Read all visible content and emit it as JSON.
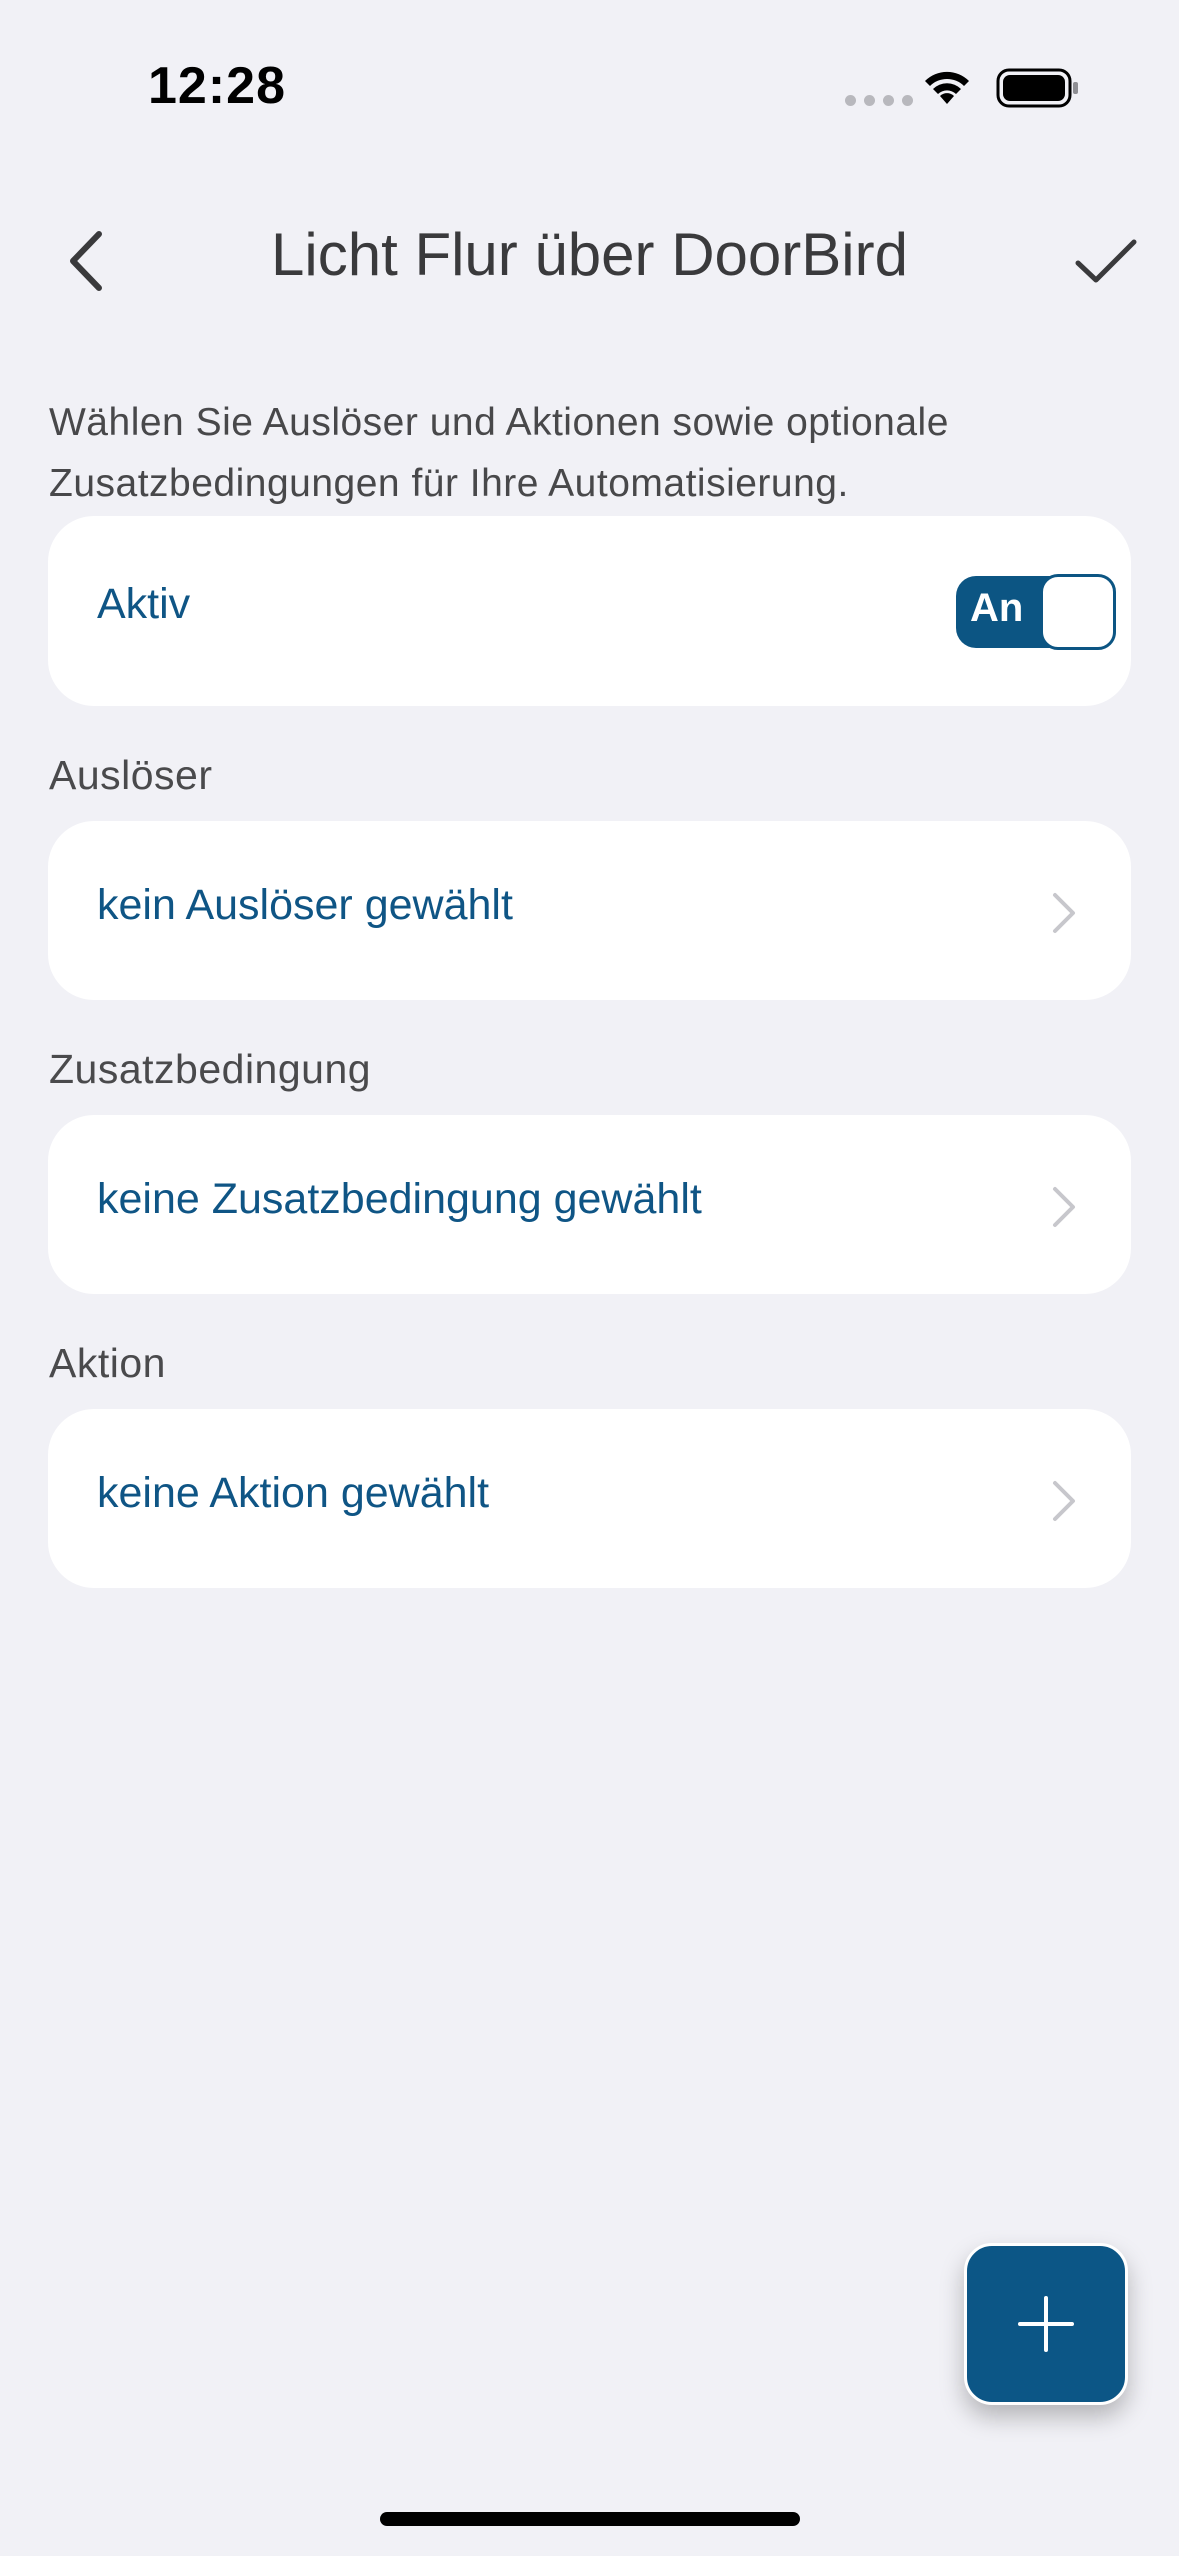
{
  "status_bar": {
    "time": "12:28",
    "icons": [
      "cellular-dots-icon",
      "wifi-icon",
      "battery-icon"
    ]
  },
  "nav": {
    "title": "Licht Flur über DoorBird",
    "back_icon": "chevron-left-icon",
    "confirm_icon": "checkmark-icon"
  },
  "intro_text": "Wählen Sie Auslöser und Aktionen sowie optionale Zusatzbedingungen für Ihre Automatisierung.",
  "active_card": {
    "label": "Aktiv",
    "toggle_text": "An",
    "toggle_on": true
  },
  "sections": {
    "trigger": {
      "header": "Auslöser",
      "value": "kein Auslöser gewählt"
    },
    "condition": {
      "header": "Zusatzbedingung",
      "value": "keine Zusatzbedingung gewählt"
    },
    "action": {
      "header": "Aktion",
      "value": "keine Aktion gewählt"
    }
  },
  "fab": {
    "icon": "plus-icon"
  },
  "colors": {
    "background": "#f1f1f6",
    "accent": "#0c5583",
    "label_blue": "#0f5585",
    "card": "#ffffff"
  }
}
